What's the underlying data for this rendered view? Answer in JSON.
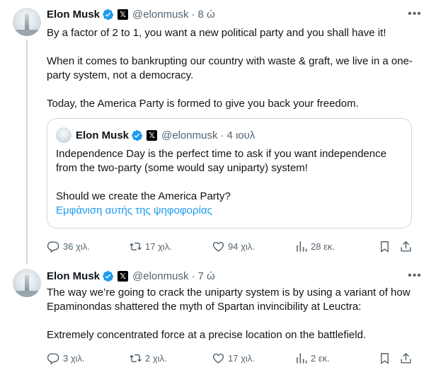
{
  "tweets": [
    {
      "name": "Elon Musk",
      "handle": "@elonmusk",
      "time": "8 ώ",
      "paragraphs": [
        "By a factor of 2 to 1, you want a new political party and you shall have it!",
        "When it comes to bankrupting our country with waste & graft, we live in a one-party system, not a democracy.",
        "Today, the America Party is formed to give you back your freedom."
      ],
      "quote": {
        "name": "Elon Musk",
        "handle": "@elonmusk",
        "time": "4 ιουλ",
        "paragraphs": [
          "Independence Day is the perfect time to ask if you want independence from the two-party (some would say uniparty) system!",
          "Should we create the America Party?"
        ],
        "link": "Εμφάνιση αυτής της ψηφοφορίας"
      },
      "stats": {
        "replies": "36 χιλ.",
        "reposts": "17 χιλ.",
        "likes": "94 χιλ.",
        "views": "28 εκ."
      }
    },
    {
      "name": "Elon Musk",
      "handle": "@elonmusk",
      "time": "7 ώ",
      "paragraphs": [
        "The way we’re going to crack the uniparty system is by using a variant of how Epaminondas shattered the myth of Spartan invincibility at Leuctra:",
        "Extremely concentrated force at a precise location on the battlefield."
      ],
      "stats": {
        "replies": "3 χιλ.",
        "reposts": "2 χιλ.",
        "likes": "17 χιλ.",
        "views": "2 εκ."
      }
    }
  ],
  "colors": {
    "accent": "#1d9bf0",
    "text": "#0f1419",
    "muted": "#536471",
    "border": "#cfd9de"
  },
  "icons": [
    "verified-badge-icon",
    "x-badge-icon",
    "more-icon",
    "reply-icon",
    "repost-icon",
    "like-icon",
    "views-icon",
    "bookmark-icon",
    "share-icon"
  ]
}
